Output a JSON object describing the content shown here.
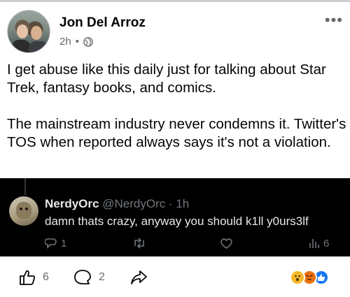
{
  "post": {
    "author": "Jon Del Arroz",
    "time": "2h",
    "separator": "•",
    "text": "I get abuse like this daily just for talking about Star Trek, fantasy books, and comics.\n\nThe mainstream industry never condemns it. Twitter's TOS when reported always says it's not a violation."
  },
  "tweet": {
    "name": "NerdyOrc",
    "handle": "@NerdyOrc · 1h",
    "text": "damn thats crazy, anyway you should k1ll y0urs3lf",
    "replies": "1",
    "views": "6"
  },
  "reactions": {
    "likes": "6",
    "comments": "2"
  },
  "colors": {
    "secondary_text": "#65676b",
    "tweet_bg": "#000000",
    "tweet_muted": "#71767b"
  }
}
